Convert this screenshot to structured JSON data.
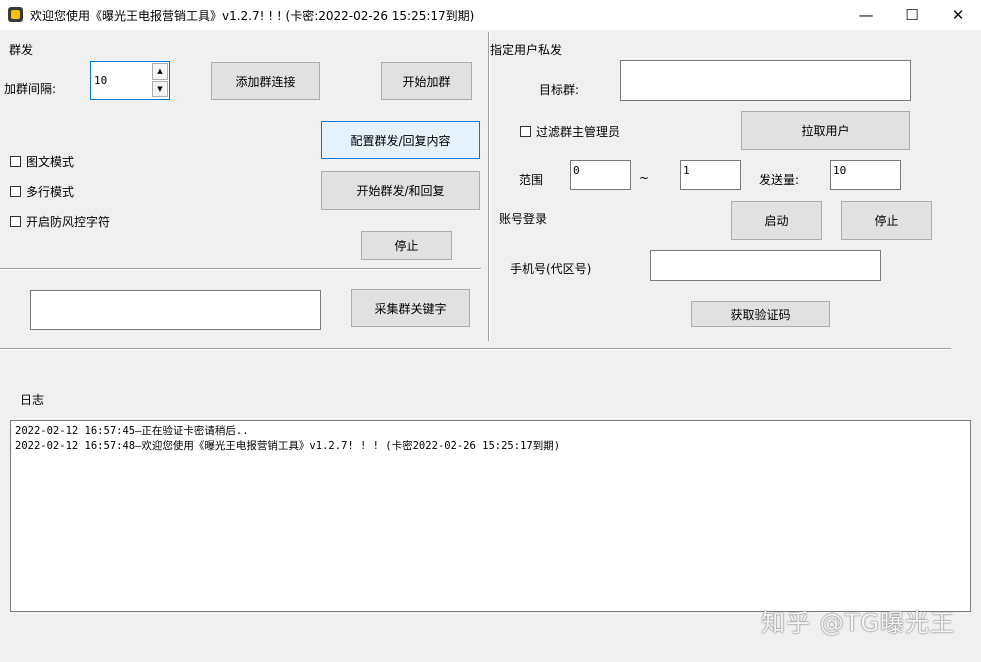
{
  "window": {
    "title": "欢迎您使用《曝光王电报营销工具》v1.2.7! ! ! (卡密:2022-02-26 15:25:17到期)",
    "controls": {
      "minimize": "—",
      "maximize": "☐",
      "close": "✕"
    }
  },
  "group_section": {
    "title": "群发",
    "interval_label": "加群间隔:",
    "interval_value": "10",
    "spin_up": "▲",
    "spin_down": "▼",
    "add_link_button": "添加群连接",
    "start_join_button": "开始加群",
    "config_button": "配置群发/回复内容",
    "start_send_button": "开始群发/和回复",
    "stop_button": "停止",
    "checkboxes": [
      "图文模式",
      "多行模式",
      "开启防风控字符"
    ],
    "keyword_value": "",
    "collect_keyword_button": "采集群关键字"
  },
  "private_section": {
    "title": "指定用户私发",
    "target_label": "目标群:",
    "target_value": "",
    "filter_admin_label": "过滤群主管理员",
    "pull_users_button": "拉取用户",
    "range_label": "范围",
    "range_from": "0",
    "range_sep": "~",
    "range_to": "1",
    "send_count_label": "发送量:",
    "send_count_value": "10"
  },
  "login_section": {
    "title": "账号登录",
    "start_button": "启动",
    "stop_button": "停止",
    "phone_label": "手机号(代区号)",
    "phone_value": "",
    "get_code_button": "获取验证码"
  },
  "log_section": {
    "title": "日志",
    "lines": [
      "2022-02-12 16:57:45—正在验证卡密请稍后..",
      "2022-02-12 16:57:48—欢迎您使用《曝光王电报营销工具》v1.2.7! ! ! (卡密2022-02-26 15:25:17到期)"
    ]
  },
  "watermark": "知乎 @TG曝光王"
}
